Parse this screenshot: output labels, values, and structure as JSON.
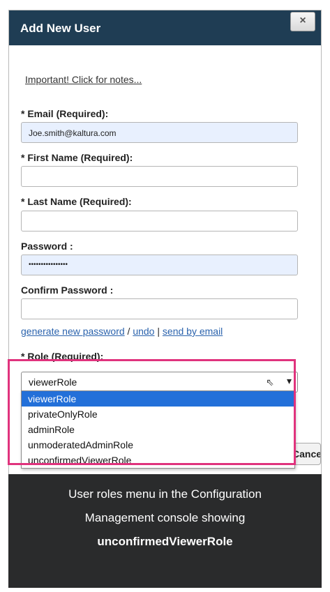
{
  "dialog": {
    "title": "Add New User",
    "close_glyph": "×",
    "notes_link": "Important! Click for notes...",
    "email": {
      "label": "* Email (Required):",
      "value": "Joe.smith@kaltura.com"
    },
    "first_name": {
      "label": "* First Name (Required):",
      "value": ""
    },
    "last_name": {
      "label": "* Last Name (Required):",
      "value": ""
    },
    "password": {
      "label": "Password :",
      "value": "••••••••••••••••"
    },
    "confirm_password": {
      "label": "Confirm Password :",
      "value": ""
    },
    "links": {
      "generate": "generate new password",
      "sep1": " / ",
      "undo": "undo",
      "sep2": " | ",
      "send": "send by email"
    },
    "role": {
      "label": "* Role (Required):",
      "selected": "viewerRole",
      "options": [
        "viewerRole",
        "privateOnlyRole",
        "adminRole",
        "unmoderatedAdminRole",
        "unconfirmedViewerRole"
      ]
    },
    "cancel_label": "Cancel"
  },
  "caption": {
    "line1": "User roles menu in the Configuration",
    "line2": "Management console showing",
    "line3": "unconfirmedViewerRole"
  },
  "colors": {
    "titlebar": "#1f3d54",
    "highlight": "#e0337d",
    "selected_option": "#2370d9",
    "caption_bg": "#2a2b2c"
  },
  "icons": {
    "close": "close-icon",
    "cursor": "mouse-cursor-icon",
    "chevron": "chevron-down-icon"
  }
}
